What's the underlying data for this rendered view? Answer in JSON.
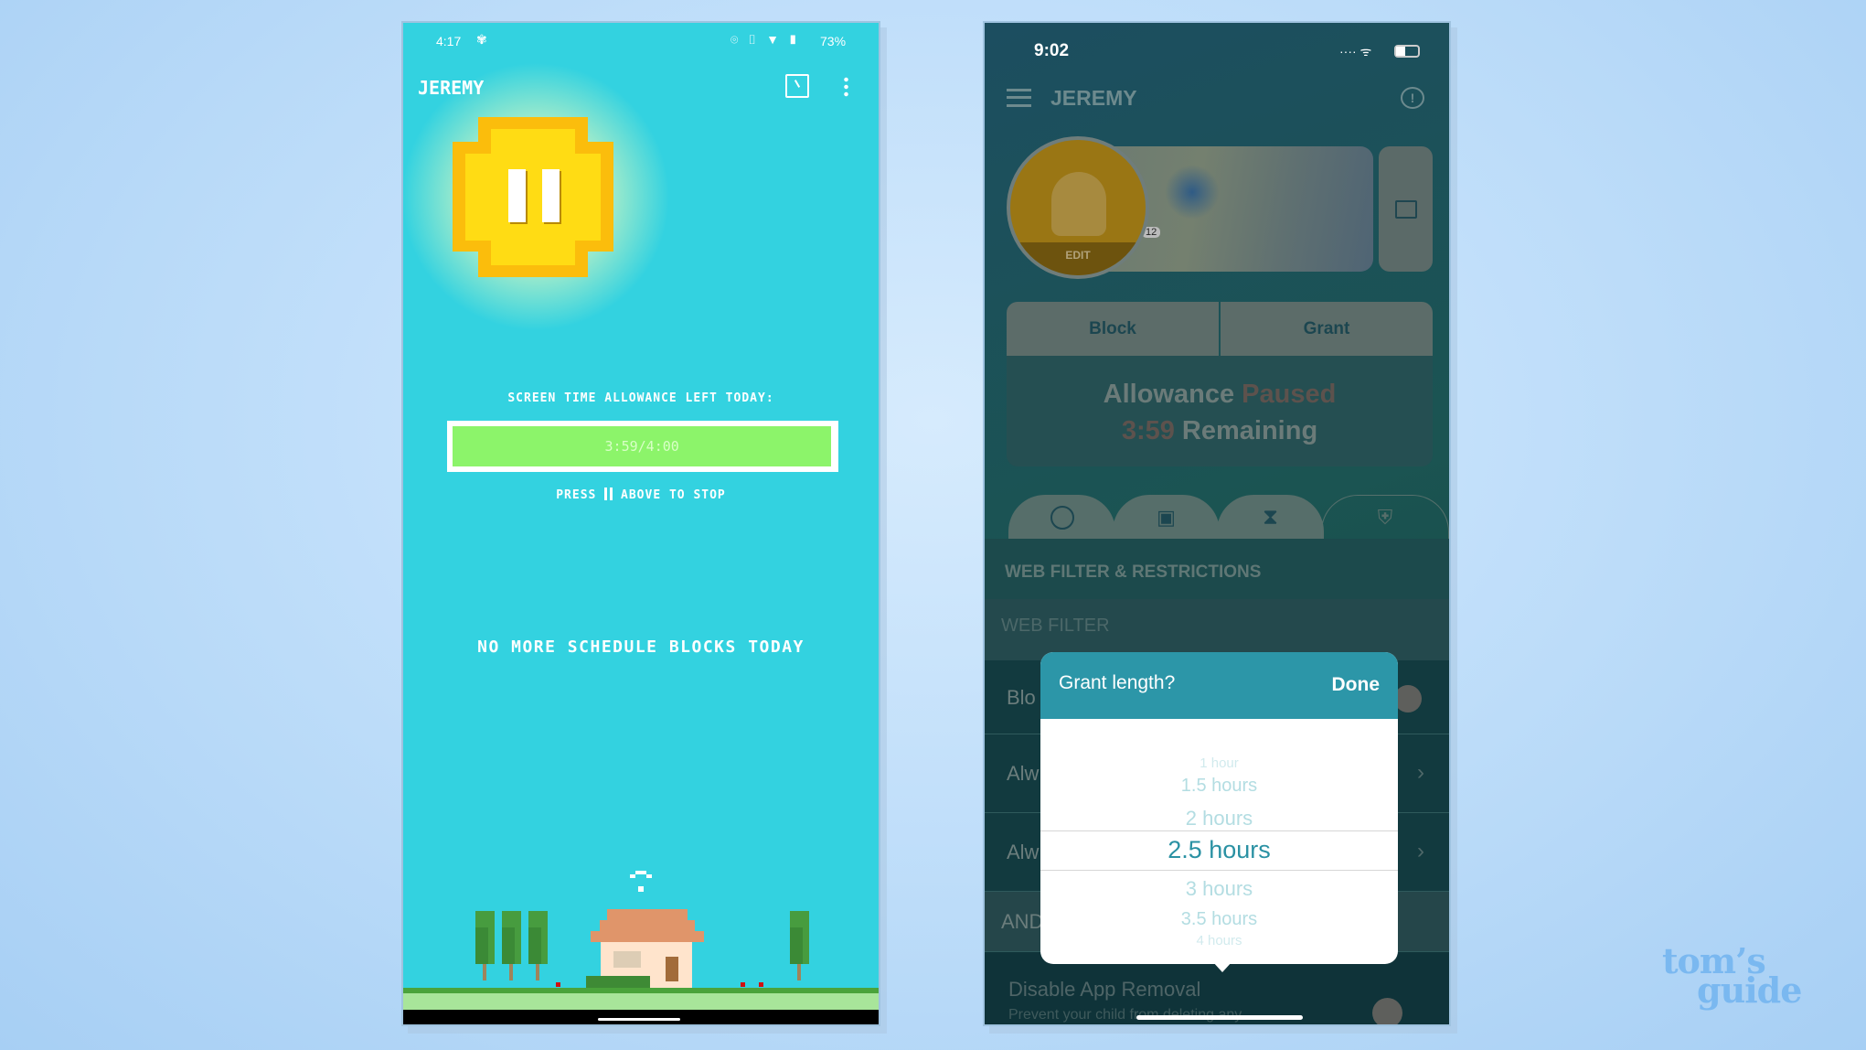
{
  "android": {
    "status": {
      "time": "4:17",
      "battery": "73%",
      "icons": [
        "fan-icon",
        "location-icon",
        "vibrate-icon",
        "wifi-icon",
        "battery-icon"
      ]
    },
    "title": "JEREMY",
    "header_icons": [
      "clock-icon",
      "more-vert-icon"
    ],
    "pause_button_icon": "pause-icon",
    "allowance_label": "SCREEN TIME ALLOWANCE LEFT TODAY:",
    "allowance_value": "3:59/4:00",
    "allowance_fraction": 0.996,
    "press_hint_before": "PRESS",
    "press_hint_after": "ABOVE TO STOP",
    "schedule_message": "NO MORE SCHEDULE BLOCKS TODAY",
    "colors": {
      "background": "#33d2e0",
      "bar": "#8cf46a",
      "coin": "#ffdc14"
    }
  },
  "ios": {
    "status": {
      "time": "9:02"
    },
    "title": "JEREMY",
    "avatar_edit": "EDIT",
    "map_route_label": "12",
    "block_button": "Block",
    "grant_button": "Grant",
    "allowance_word": "Allowance",
    "allowance_state": "Paused",
    "remaining_time": "3:59",
    "remaining_word": "Remaining",
    "tabs": [
      "clock-icon",
      "apps-icon",
      "hourglass-icon",
      "shield-x-icon"
    ],
    "section_title": "WEB FILTER & RESTRICTIONS",
    "web_filter_header": "WEB FILTER",
    "rows": [
      "Blo",
      "Alw",
      "Alw",
      "AND"
    ],
    "disable_title": "Disable App Removal",
    "disable_sub": "Prevent your child from deleting any",
    "popup": {
      "title": "Grant length?",
      "done": "Done",
      "options": [
        "1 hour",
        "1.5 hours",
        "2 hours",
        "2.5 hours",
        "3 hours",
        "3.5 hours",
        "4 hours"
      ],
      "selected": "2.5 hours"
    }
  },
  "watermark": "tom's guide"
}
